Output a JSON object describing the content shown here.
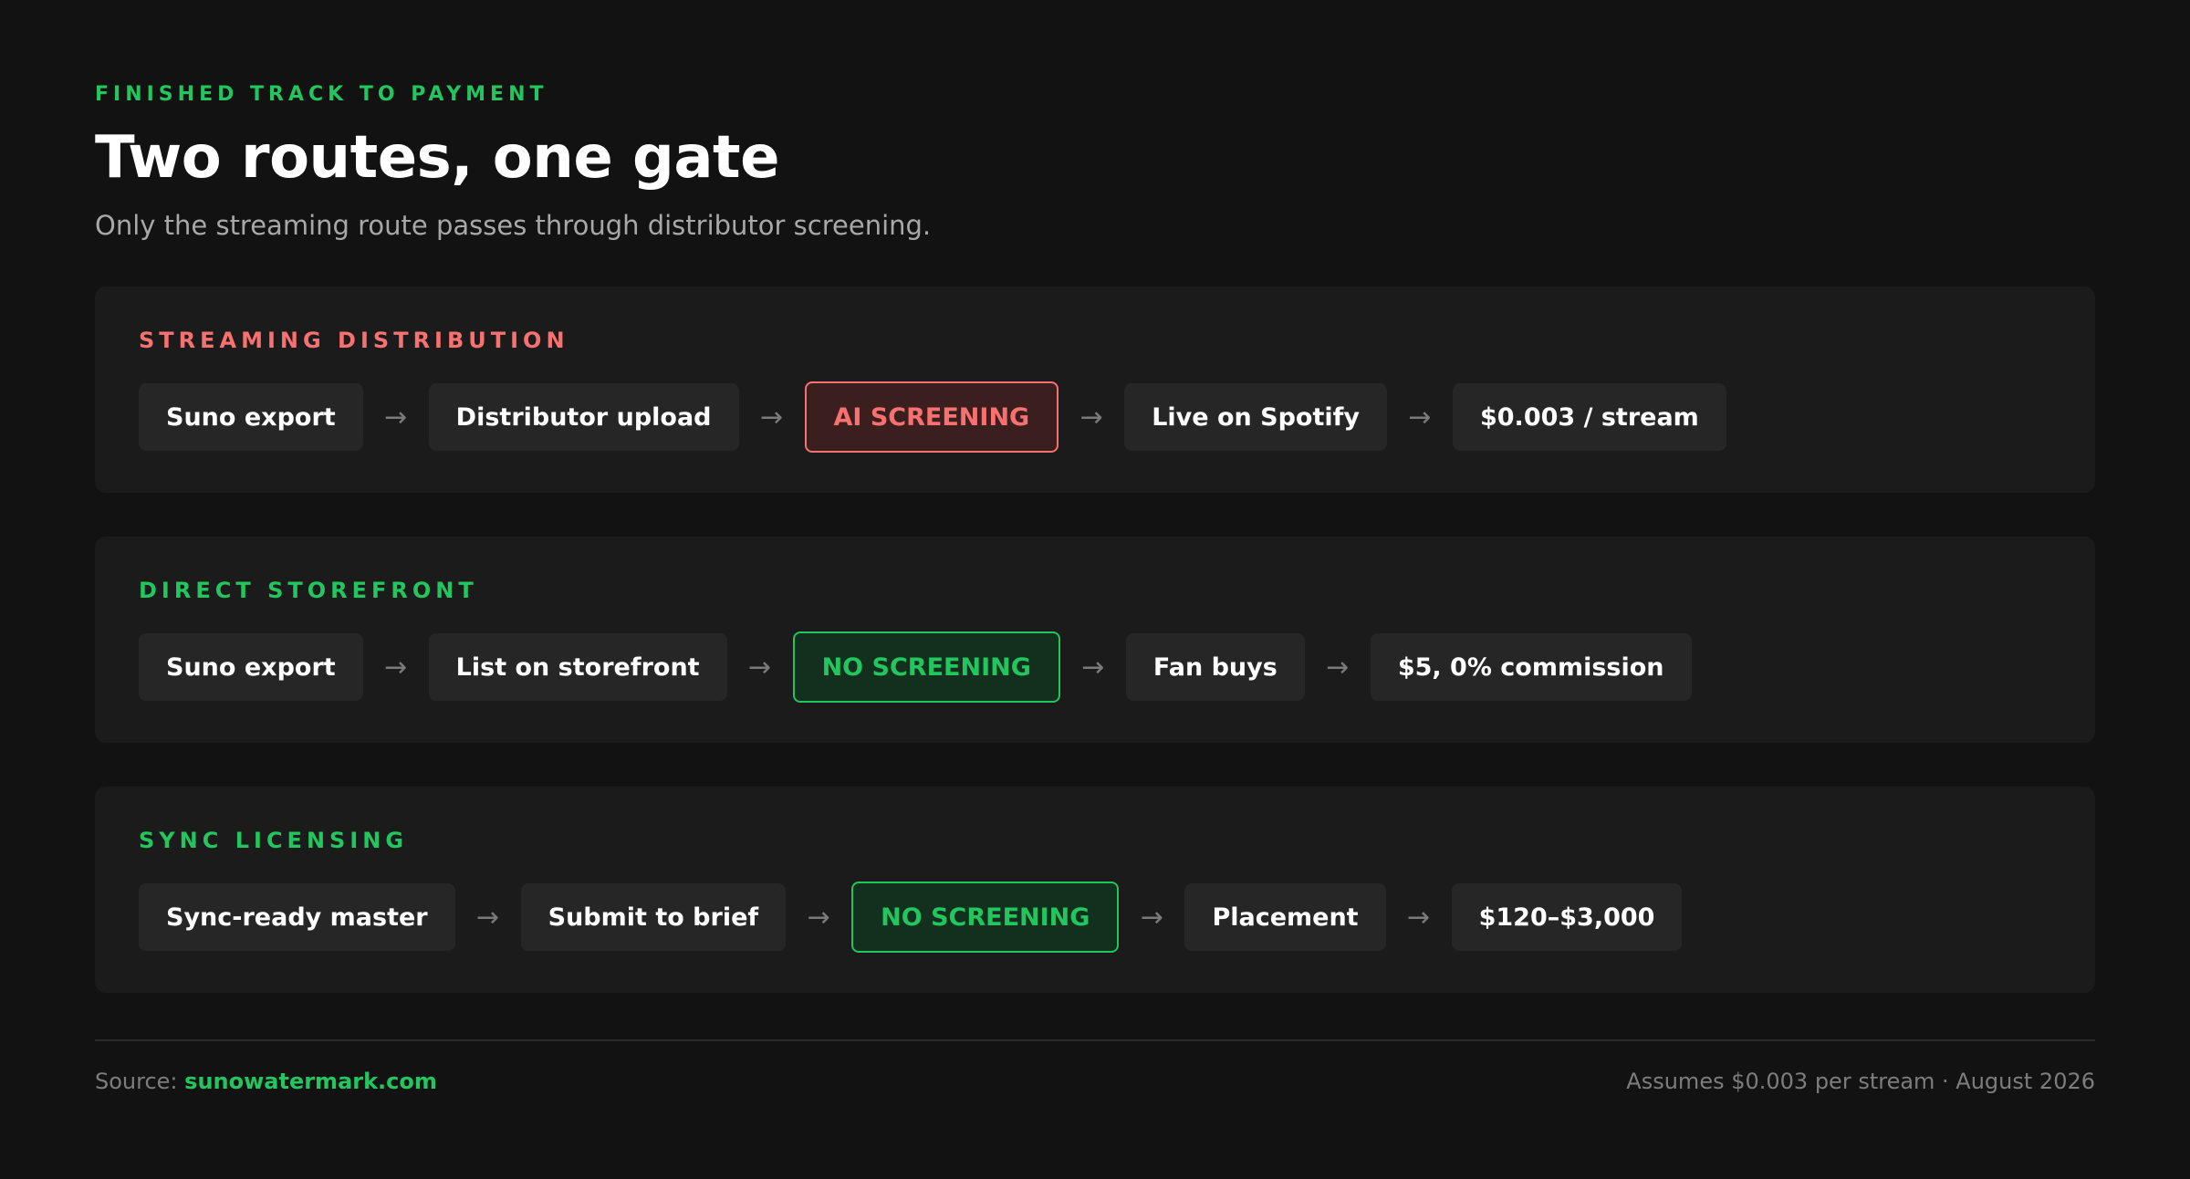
{
  "header": {
    "eyebrow": "FINISHED TRACK TO PAYMENT",
    "title": "Two routes, one gate",
    "subtitle": "Only the streaming route passes through distributor screening."
  },
  "colors": {
    "accent_green": "#22c55e",
    "accent_red": "#f87171",
    "gate_red_bg": "#3b1f1f",
    "gate_green_bg": "#12301d",
    "arrow_glyph": "→"
  },
  "routes": [
    {
      "label": "STREAMING DISTRIBUTION",
      "label_color": "#f87171",
      "steps": [
        {
          "text": "Suno export",
          "kind": "step"
        },
        {
          "text": "Distributor upload",
          "kind": "step"
        },
        {
          "text": "AI SCREENING",
          "kind": "gate-red"
        },
        {
          "text": "Live on Spotify",
          "kind": "step"
        },
        {
          "text": "$0.003 / stream",
          "kind": "step"
        }
      ]
    },
    {
      "label": "DIRECT STOREFRONT",
      "label_color": "#22c55e",
      "steps": [
        {
          "text": "Suno export",
          "kind": "step"
        },
        {
          "text": "List on storefront",
          "kind": "step"
        },
        {
          "text": "NO SCREENING",
          "kind": "gate-green"
        },
        {
          "text": "Fan buys",
          "kind": "step"
        },
        {
          "text": "$5, 0% commission",
          "kind": "step"
        }
      ]
    },
    {
      "label": "SYNC LICENSING",
      "label_color": "#22c55e",
      "steps": [
        {
          "text": "Sync-ready master",
          "kind": "step"
        },
        {
          "text": "Submit to brief",
          "kind": "step"
        },
        {
          "text": "NO SCREENING",
          "kind": "gate-green"
        },
        {
          "text": "Placement",
          "kind": "step"
        },
        {
          "text": "$120–$3,000",
          "kind": "step"
        }
      ]
    }
  ],
  "footer": {
    "source_prefix": "Source:",
    "source_link": "sunowatermark.com",
    "note": "Assumes $0.003 per stream · August 2026"
  }
}
